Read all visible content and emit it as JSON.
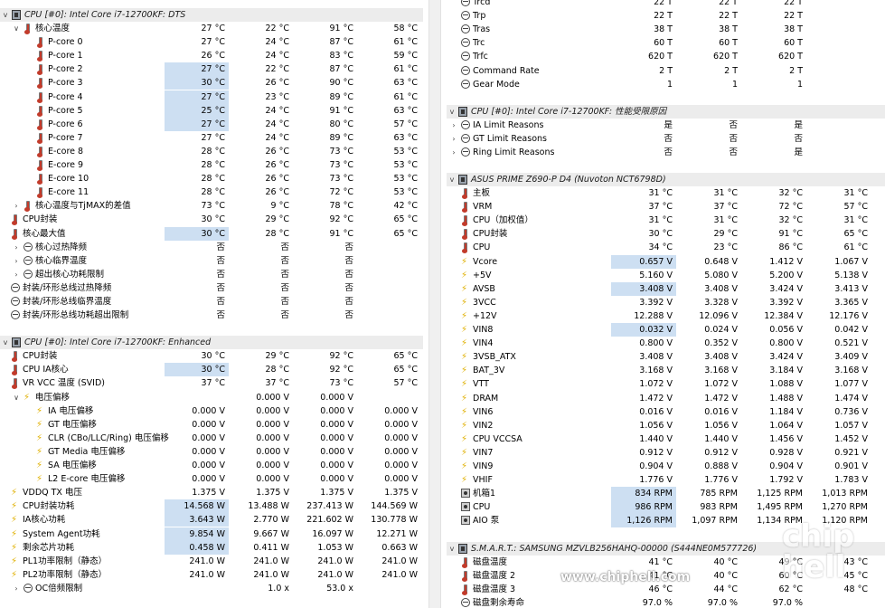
{
  "left_panel": {
    "sections": [
      {
        "title": "CPU [#0]: Intel Core i7-12700KF: DTS",
        "rows": [
          {
            "label": "核心温度",
            "icon": "thermometer-icon",
            "tw": "v",
            "indent": 1,
            "values": [
              "27 °C",
              "22 °C",
              "91 °C",
              "58 °C"
            ]
          },
          {
            "label": "P-core 0",
            "icon": "thermometer-icon",
            "indent": 2,
            "hl": false,
            "values": [
              "27 °C",
              "24 °C",
              "87 °C",
              "61 °C"
            ]
          },
          {
            "label": "P-core 1",
            "icon": "thermometer-icon",
            "indent": 2,
            "hl": false,
            "values": [
              "26 °C",
              "24 °C",
              "83 °C",
              "59 °C"
            ]
          },
          {
            "label": "P-core 2",
            "icon": "thermometer-icon",
            "indent": 2,
            "hl": true,
            "values": [
              "27 °C",
              "22 °C",
              "87 °C",
              "61 °C"
            ]
          },
          {
            "label": "P-core 3",
            "icon": "thermometer-icon",
            "indent": 2,
            "hl": true,
            "values": [
              "30 °C",
              "26 °C",
              "90 °C",
              "63 °C"
            ]
          },
          {
            "label": "P-core 4",
            "icon": "thermometer-icon",
            "indent": 2,
            "hl": true,
            "values": [
              "27 °C",
              "23 °C",
              "89 °C",
              "61 °C"
            ]
          },
          {
            "label": "P-core 5",
            "icon": "thermometer-icon",
            "indent": 2,
            "hl": true,
            "values": [
              "25 °C",
              "24 °C",
              "91 °C",
              "63 °C"
            ]
          },
          {
            "label": "P-core 6",
            "icon": "thermometer-icon",
            "indent": 2,
            "hl": true,
            "values": [
              "27 °C",
              "24 °C",
              "80 °C",
              "57 °C"
            ]
          },
          {
            "label": "P-core 7",
            "icon": "thermometer-icon",
            "indent": 2,
            "hl": false,
            "values": [
              "27 °C",
              "24 °C",
              "89 °C",
              "63 °C"
            ]
          },
          {
            "label": "E-core 8",
            "icon": "thermometer-icon",
            "indent": 2,
            "hl": false,
            "values": [
              "28 °C",
              "26 °C",
              "73 °C",
              "53 °C"
            ]
          },
          {
            "label": "E-core 9",
            "icon": "thermometer-icon",
            "indent": 2,
            "hl": false,
            "values": [
              "28 °C",
              "26 °C",
              "73 °C",
              "53 °C"
            ]
          },
          {
            "label": "E-core 10",
            "icon": "thermometer-icon",
            "indent": 2,
            "hl": false,
            "values": [
              "28 °C",
              "26 °C",
              "73 °C",
              "53 °C"
            ]
          },
          {
            "label": "E-core 11",
            "icon": "thermometer-icon",
            "indent": 2,
            "hl": false,
            "values": [
              "28 °C",
              "26 °C",
              "72 °C",
              "53 °C"
            ]
          },
          {
            "label": "核心温度与TjMAX的差值",
            "icon": "thermometer-icon",
            "tw": ">",
            "indent": 1,
            "values": [
              "73 °C",
              "9 °C",
              "78 °C",
              "42 °C"
            ]
          },
          {
            "label": "CPU封装",
            "icon": "thermometer-icon",
            "indent": 0,
            "values": [
              "30 °C",
              "29 °C",
              "92 °C",
              "65 °C"
            ]
          },
          {
            "label": "核心最大值",
            "icon": "thermometer-icon",
            "indent": 0,
            "hl": true,
            "values": [
              "30 °C",
              "28 °C",
              "91 °C",
              "65 °C"
            ]
          },
          {
            "label": "核心过热降频",
            "icon": "clock-icon",
            "tw": ">",
            "indent": 1,
            "values": [
              "否",
              "否",
              "否",
              ""
            ]
          },
          {
            "label": "核心临界温度",
            "icon": "clock-icon",
            "tw": ">",
            "indent": 1,
            "values": [
              "否",
              "否",
              "否",
              ""
            ]
          },
          {
            "label": "超出核心功耗限制",
            "icon": "clock-icon",
            "tw": ">",
            "indent": 1,
            "values": [
              "否",
              "否",
              "否",
              ""
            ]
          },
          {
            "label": "封装/环形总线过热降频",
            "icon": "clock-icon",
            "indent": 0,
            "values": [
              "否",
              "否",
              "否",
              ""
            ]
          },
          {
            "label": "封装/环形总线临界温度",
            "icon": "clock-icon",
            "indent": 0,
            "values": [
              "否",
              "否",
              "否",
              ""
            ]
          },
          {
            "label": "封装/环形总线功耗超出限制",
            "icon": "clock-icon",
            "indent": 0,
            "values": [
              "否",
              "否",
              "否",
              ""
            ]
          }
        ]
      },
      {
        "title": "CPU [#0]: Intel Core i7-12700KF: Enhanced",
        "rows": [
          {
            "label": "CPU封装",
            "icon": "thermometer-icon",
            "indent": 0,
            "values": [
              "30 °C",
              "29 °C",
              "92 °C",
              "65 °C"
            ]
          },
          {
            "label": "CPU IA核心",
            "icon": "thermometer-icon",
            "indent": 0,
            "hl": true,
            "values": [
              "30 °C",
              "28 °C",
              "92 °C",
              "65 °C"
            ]
          },
          {
            "label": "VR VCC 温度 (SVID)",
            "icon": "thermometer-icon",
            "indent": 0,
            "values": [
              "37 °C",
              "37 °C",
              "73 °C",
              "57 °C"
            ]
          },
          {
            "label": "电压偏移",
            "icon": "bolt-icon",
            "tw": "v",
            "indent": 1,
            "values": [
              "",
              "0.000 V",
              "0.000 V",
              ""
            ]
          },
          {
            "label": "IA 电压偏移",
            "icon": "bolt-icon",
            "indent": 2,
            "values": [
              "0.000 V",
              "0.000 V",
              "0.000 V",
              "0.000 V"
            ]
          },
          {
            "label": "GT 电压偏移",
            "icon": "bolt-icon",
            "indent": 2,
            "values": [
              "0.000 V",
              "0.000 V",
              "0.000 V",
              "0.000 V"
            ]
          },
          {
            "label": "CLR (CBo/LLC/Ring) 电压偏移",
            "icon": "bolt-icon",
            "indent": 2,
            "values": [
              "0.000 V",
              "0.000 V",
              "0.000 V",
              "0.000 V"
            ]
          },
          {
            "label": "GT Media 电压偏移",
            "icon": "bolt-icon",
            "indent": 2,
            "values": [
              "0.000 V",
              "0.000 V",
              "0.000 V",
              "0.000 V"
            ]
          },
          {
            "label": "SA 电压偏移",
            "icon": "bolt-icon",
            "indent": 2,
            "values": [
              "0.000 V",
              "0.000 V",
              "0.000 V",
              "0.000 V"
            ]
          },
          {
            "label": "L2 E-core 电压偏移",
            "icon": "bolt-icon",
            "indent": 2,
            "values": [
              "0.000 V",
              "0.000 V",
              "0.000 V",
              "0.000 V"
            ]
          },
          {
            "label": "VDDQ TX 电压",
            "icon": "bolt-icon",
            "indent": 0,
            "values": [
              "1.375 V",
              "1.375 V",
              "1.375 V",
              "1.375 V"
            ]
          },
          {
            "label": "CPU封装功耗",
            "icon": "bolt-icon",
            "indent": 0,
            "hl": true,
            "values": [
              "14.568 W",
              "13.488 W",
              "237.413 W",
              "144.569 W"
            ]
          },
          {
            "label": "IA核心功耗",
            "icon": "bolt-icon",
            "indent": 0,
            "hl": true,
            "values": [
              "3.643 W",
              "2.770 W",
              "221.602 W",
              "130.778 W"
            ]
          },
          {
            "label": "System Agent功耗",
            "icon": "bolt-icon",
            "indent": 0,
            "hl": true,
            "values": [
              "9.854 W",
              "9.667 W",
              "16.097 W",
              "12.271 W"
            ]
          },
          {
            "label": "剩余芯片功耗",
            "icon": "bolt-icon",
            "indent": 0,
            "hl": true,
            "values": [
              "0.458 W",
              "0.411 W",
              "1.053 W",
              "0.663 W"
            ]
          },
          {
            "label": "PL1功率限制（静态）",
            "icon": "bolt-icon",
            "indent": 0,
            "values": [
              "241.0 W",
              "241.0 W",
              "241.0 W",
              "241.0 W"
            ]
          },
          {
            "label": "PL2功率限制（静态）",
            "icon": "bolt-icon",
            "indent": 0,
            "values": [
              "241.0 W",
              "241.0 W",
              "241.0 W",
              "241.0 W"
            ]
          },
          {
            "label": "OC倍频限制",
            "icon": "clock-icon",
            "tw": ">",
            "indent": 1,
            "values": [
              "",
              "1.0 x",
              "53.0 x",
              ""
            ]
          }
        ]
      }
    ]
  },
  "right_panel": {
    "top_rows": [
      {
        "label": "Trcd",
        "icon": "clock-icon",
        "values": [
          "22 T",
          "22 T",
          "22 T",
          ""
        ]
      },
      {
        "label": "Trp",
        "icon": "clock-icon",
        "values": [
          "22 T",
          "22 T",
          "22 T",
          ""
        ]
      },
      {
        "label": "Tras",
        "icon": "clock-icon",
        "values": [
          "38 T",
          "38 T",
          "38 T",
          ""
        ]
      },
      {
        "label": "Trc",
        "icon": "clock-icon",
        "values": [
          "60 T",
          "60 T",
          "60 T",
          ""
        ]
      },
      {
        "label": "Trfc",
        "icon": "clock-icon",
        "values": [
          "620 T",
          "620 T",
          "620 T",
          ""
        ]
      },
      {
        "label": "Command Rate",
        "icon": "clock-icon",
        "values": [
          "2 T",
          "2 T",
          "2 T",
          ""
        ]
      },
      {
        "label": "Gear Mode",
        "icon": "clock-icon",
        "values": [
          "1",
          "1",
          "1",
          ""
        ]
      }
    ],
    "sections": [
      {
        "title": "CPU [#0]: Intel Core i7-12700KF: 性能受限原因",
        "rows": [
          {
            "label": "IA Limit Reasons",
            "icon": "clock-icon",
            "tw": ">",
            "values": [
              "是",
              "否",
              "是",
              ""
            ]
          },
          {
            "label": "GT Limit Reasons",
            "icon": "clock-icon",
            "tw": ">",
            "values": [
              "否",
              "否",
              "否",
              ""
            ]
          },
          {
            "label": "Ring Limit Reasons",
            "icon": "clock-icon",
            "tw": ">",
            "values": [
              "否",
              "否",
              "是",
              ""
            ]
          }
        ]
      },
      {
        "title": "ASUS PRIME Z690-P D4 (Nuvoton NCT6798D)",
        "rows": [
          {
            "label": "主板",
            "icon": "thermometer-icon",
            "values": [
              "31 °C",
              "31 °C",
              "32 °C",
              "31 °C"
            ]
          },
          {
            "label": "VRM",
            "icon": "thermometer-icon",
            "values": [
              "37 °C",
              "37 °C",
              "72 °C",
              "57 °C"
            ]
          },
          {
            "label": "CPU（加权值）",
            "icon": "thermometer-icon",
            "values": [
              "31 °C",
              "31 °C",
              "32 °C",
              "31 °C"
            ]
          },
          {
            "label": "CPU封装",
            "icon": "thermometer-icon",
            "values": [
              "30 °C",
              "29 °C",
              "91 °C",
              "65 °C"
            ]
          },
          {
            "label": "CPU",
            "icon": "thermometer-icon",
            "values": [
              "34 °C",
              "23 °C",
              "86 °C",
              "61 °C"
            ]
          },
          {
            "label": "Vcore",
            "icon": "bolt-icon",
            "hl": true,
            "values": [
              "0.657 V",
              "0.648 V",
              "1.412 V",
              "1.067 V"
            ]
          },
          {
            "label": "+5V",
            "icon": "bolt-icon",
            "values": [
              "5.160 V",
              "5.080 V",
              "5.200 V",
              "5.138 V"
            ]
          },
          {
            "label": "AVSB",
            "icon": "bolt-icon",
            "hl": true,
            "values": [
              "3.408 V",
              "3.408 V",
              "3.424 V",
              "3.413 V"
            ]
          },
          {
            "label": "3VCC",
            "icon": "bolt-icon",
            "values": [
              "3.392 V",
              "3.328 V",
              "3.392 V",
              "3.365 V"
            ]
          },
          {
            "label": "+12V",
            "icon": "bolt-icon",
            "values": [
              "12.288 V",
              "12.096 V",
              "12.384 V",
              "12.176 V"
            ]
          },
          {
            "label": "VIN8",
            "icon": "bolt-icon",
            "hl": true,
            "values": [
              "0.032 V",
              "0.024 V",
              "0.056 V",
              "0.042 V"
            ]
          },
          {
            "label": "VIN4",
            "icon": "bolt-icon",
            "values": [
              "0.800 V",
              "0.352 V",
              "0.800 V",
              "0.521 V"
            ]
          },
          {
            "label": "3VSB_ATX",
            "icon": "bolt-icon",
            "values": [
              "3.408 V",
              "3.408 V",
              "3.424 V",
              "3.409 V"
            ]
          },
          {
            "label": "BAT_3V",
            "icon": "bolt-icon",
            "values": [
              "3.168 V",
              "3.168 V",
              "3.184 V",
              "3.168 V"
            ]
          },
          {
            "label": "VTT",
            "icon": "bolt-icon",
            "values": [
              "1.072 V",
              "1.072 V",
              "1.088 V",
              "1.077 V"
            ]
          },
          {
            "label": "DRAM",
            "icon": "bolt-icon",
            "values": [
              "1.472 V",
              "1.472 V",
              "1.488 V",
              "1.474 V"
            ]
          },
          {
            "label": "VIN6",
            "icon": "bolt-icon",
            "values": [
              "0.016 V",
              "0.016 V",
              "1.184 V",
              "0.736 V"
            ]
          },
          {
            "label": "VIN2",
            "icon": "bolt-icon",
            "values": [
              "1.056 V",
              "1.056 V",
              "1.064 V",
              "1.057 V"
            ]
          },
          {
            "label": "CPU VCCSA",
            "icon": "bolt-icon",
            "values": [
              "1.440 V",
              "1.440 V",
              "1.456 V",
              "1.452 V"
            ]
          },
          {
            "label": "VIN7",
            "icon": "bolt-icon",
            "values": [
              "0.912 V",
              "0.912 V",
              "0.928 V",
              "0.921 V"
            ]
          },
          {
            "label": "VIN9",
            "icon": "bolt-icon",
            "values": [
              "0.904 V",
              "0.888 V",
              "0.904 V",
              "0.901 V"
            ]
          },
          {
            "label": "VHIF",
            "icon": "bolt-icon",
            "values": [
              "1.776 V",
              "1.776 V",
              "1.792 V",
              "1.783 V"
            ]
          },
          {
            "label": "机箱1",
            "icon": "fan-icon",
            "hl": true,
            "values": [
              "834 RPM",
              "785 RPM",
              "1,125 RPM",
              "1,013 RPM"
            ]
          },
          {
            "label": "CPU",
            "icon": "fan-icon",
            "hl": true,
            "values": [
              "986 RPM",
              "983 RPM",
              "1,495 RPM",
              "1,270 RPM"
            ]
          },
          {
            "label": "AIO 泵",
            "icon": "fan-icon",
            "hl": true,
            "values": [
              "1,126 RPM",
              "1,097 RPM",
              "1,134 RPM",
              "1,120 RPM"
            ]
          }
        ]
      },
      {
        "title": "S.M.A.R.T.: SAMSUNG MZVLB256HAHQ-00000 (S444NE0M577726)",
        "rows": [
          {
            "label": "磁盘温度",
            "icon": "thermometer-icon",
            "values": [
              "41 °C",
              "40 °C",
              "49 °C",
              "43 °C"
            ]
          },
          {
            "label": "磁盘温度 2",
            "icon": "thermometer-icon",
            "values": [
              "41 °C",
              "40 °C",
              "60 °C",
              "45 °C"
            ]
          },
          {
            "label": "磁盘温度 3",
            "icon": "thermometer-icon",
            "values": [
              "46 °C",
              "44 °C",
              "62 °C",
              "48 °C"
            ]
          },
          {
            "label": "磁盘剩余寿命",
            "icon": "clock-icon",
            "values": [
              "97.0 %",
              "97.0 %",
              "97.0 %",
              ""
            ]
          }
        ]
      }
    ]
  },
  "watermark": {
    "text": "www.chiphell.com",
    "logo": "chip hell"
  }
}
